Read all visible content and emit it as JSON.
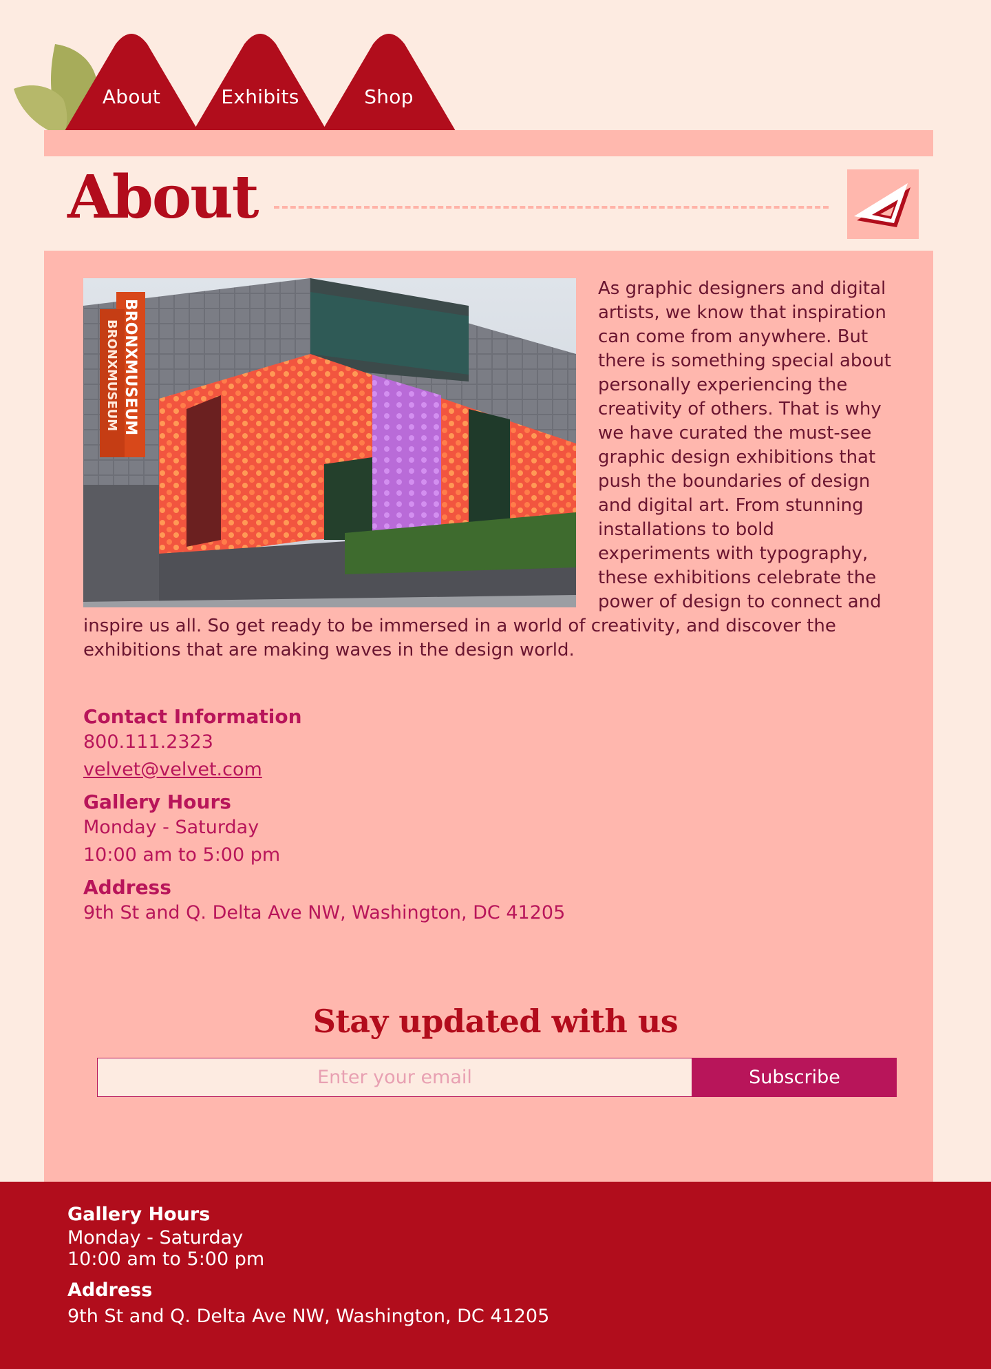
{
  "brand": {
    "colors": {
      "page_bg": "#fdebe1",
      "primary_red": "#b10d1c",
      "panel_pink": "#ffb7ae",
      "accent_magenta": "#b8155a",
      "leaf_green": "#a7ac5a"
    }
  },
  "nav": {
    "items": [
      {
        "label": "About"
      },
      {
        "label": "Exhibits"
      },
      {
        "label": "Shop"
      }
    ]
  },
  "title": {
    "text": "About",
    "badge_icon": "triangle-ruler-icon"
  },
  "intro": {
    "image_alt": "Bronx Museum building exterior with colorful mural windows",
    "banner_text": "BRONXMUSEUM",
    "body": "As graphic designers and digital artists, we know that inspiration can come from anywhere. But there is something special about personally experiencing the creativity of others. That is why we have curated the must-see graphic design exhibitions that push the boundaries of design and digital art. From stunning installations to bold experiments with typography, these exhibitions celebrate the power of design to connect and inspire us all. So get ready to be immersed in a world of creativity, and discover the exhibitions that are making waves in the design world."
  },
  "contact": {
    "heading": "Contact Information",
    "phone": "800.111.2323",
    "email": "velvet@velvet.com"
  },
  "hours": {
    "heading": "Gallery Hours",
    "days": "Monday - Saturday",
    "time": "10:00 am to 5:00 pm"
  },
  "address": {
    "heading": "Address",
    "text": "9th St and Q. Delta Ave NW, Washington, DC 41205"
  },
  "subscribe": {
    "title": "Stay updated with us",
    "email_value": "",
    "email_placeholder": "Enter your email",
    "button_label": "Subscribe"
  },
  "footer": {
    "hours_heading": "Gallery Hours",
    "hours_days": "Monday - Saturday",
    "hours_time": "10:00 am to 5:00 pm",
    "address_heading": "Address",
    "address_text": "9th St and Q. Delta Ave NW, Washington, DC 41205"
  }
}
